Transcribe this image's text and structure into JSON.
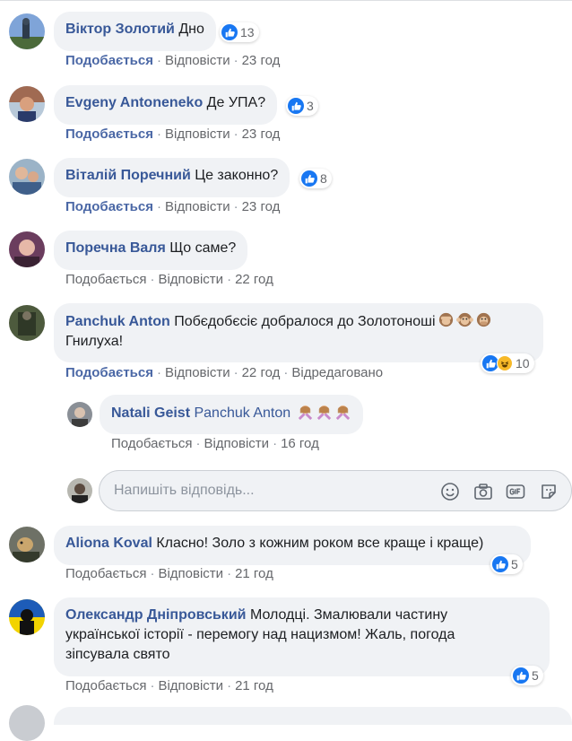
{
  "colors": {
    "author": "#385898",
    "bubble": "#f0f2f5",
    "meta": "#65676b",
    "like_blue": "#1877f2"
  },
  "labels": {
    "like": "Подобається",
    "reply": "Відповісти",
    "separator": "·"
  },
  "comments": [
    {
      "author": "Віктор Золотий",
      "text": "Дно",
      "time": "23 год",
      "reactions": "13",
      "reaction_types": [
        "like"
      ],
      "like_bold": true
    },
    {
      "author": "Evgeny Antoneneko",
      "text": "Де УПА?",
      "time": "23 год",
      "reactions": "3",
      "reaction_types": [
        "like"
      ],
      "like_bold": true
    },
    {
      "author": "Віталій Поречний",
      "text": "Це законно?",
      "time": "23 год",
      "reactions": "8",
      "reaction_types": [
        "like"
      ],
      "like_bold": true
    },
    {
      "author": "Поречна Валя",
      "text": "Що саме?",
      "time": "22 год",
      "like_bold": false
    },
    {
      "author": "Panchuk Anton",
      "text_line1": "Побєдобєсіє добралося до Золотоноші",
      "text_line2": "Гнилуха!",
      "emojis": [
        "see-no-evil-monkey",
        "hear-no-evil-monkey",
        "speak-no-evil-monkey"
      ],
      "time": "22 год",
      "edited": "Відредаговано",
      "reactions": "10",
      "reaction_types": [
        "like",
        "haha"
      ],
      "like_bold": true
    },
    {
      "author": "Natali Geist",
      "mention": "Panchuk Anton",
      "emojis": [
        "woman-gesturing-no",
        "woman-gesturing-no",
        "woman-gesturing-no"
      ],
      "time": "16 год",
      "like_bold": false,
      "is_reply": true
    },
    {
      "author": "Aliona Koval",
      "text": "Класно! Золо з кожним роком все краще і краще)",
      "time": "21 год",
      "reactions": "5",
      "reaction_types": [
        "like"
      ],
      "like_bold": false
    },
    {
      "author": "Олександр Дніпровський",
      "text_line1": "Молодці. Змалювали частину",
      "text_line2": "української історії - перемогу над нацизмом! Жаль, погода",
      "text_line3": "зіпсувала свято",
      "time": "21 год",
      "reactions": "5",
      "reaction_types": [
        "like"
      ],
      "like_bold": false
    }
  ],
  "reply_input": {
    "placeholder": "Напишіть відповідь...",
    "icons": [
      "emoji-icon",
      "camera-icon",
      "gif-icon",
      "sticker-icon"
    ]
  }
}
